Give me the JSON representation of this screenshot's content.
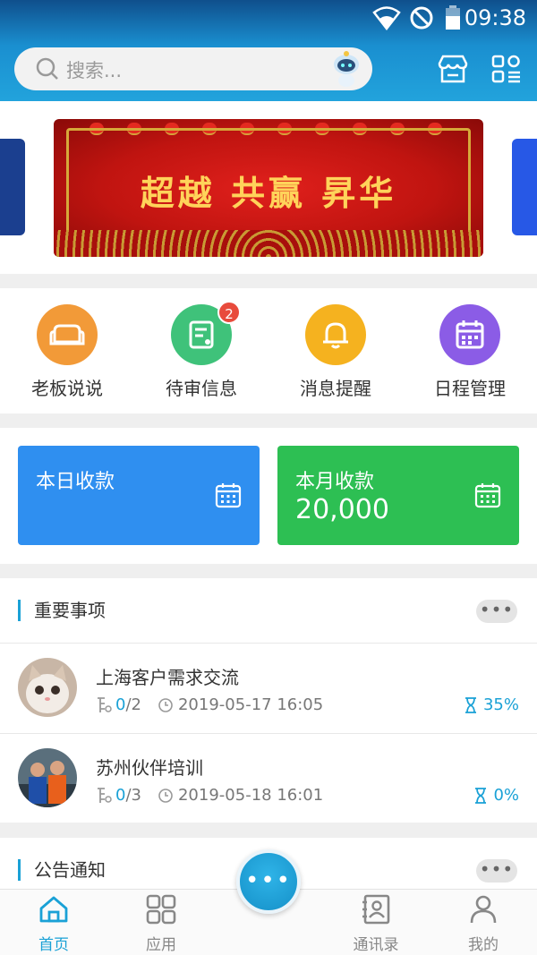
{
  "status_bar": {
    "time": "09:38"
  },
  "search": {
    "placeholder": "搜索..."
  },
  "banner": {
    "slogan": "超越 共赢 昇华"
  },
  "quick_actions": [
    {
      "label": "老板说说",
      "icon": "sofa-icon",
      "color": "#f29a38"
    },
    {
      "label": "待审信息",
      "icon": "review-document-icon",
      "color": "#3fc27a",
      "badge": "2"
    },
    {
      "label": "消息提醒",
      "icon": "bell-icon",
      "color": "#f5b21f"
    },
    {
      "label": "日程管理",
      "icon": "calendar-icon",
      "color": "#8b5ce6"
    }
  ],
  "stats": [
    {
      "title": "本日收款",
      "value": "",
      "color": "#2f8ff0"
    },
    {
      "title": "本月收款",
      "value": "20,000",
      "color": "#2dbf53"
    }
  ],
  "important": {
    "title": "重要事项",
    "more": "•••",
    "items": [
      {
        "name": "上海客户需求交流",
        "done": "0",
        "total": "/2",
        "time": "2019-05-17 16:05",
        "progress": "35%"
      },
      {
        "name": "苏州伙伴培训",
        "done": "0",
        "total": "/3",
        "time": "2019-05-18 16:01",
        "progress": "0%"
      }
    ]
  },
  "notice": {
    "title": "公告通知",
    "more": "•••"
  },
  "tabs": [
    {
      "label": "首页",
      "icon": "home-icon",
      "active": true
    },
    {
      "label": "应用",
      "icon": "apps-grid-icon"
    },
    {
      "label": "通讯录",
      "icon": "contacts-icon"
    },
    {
      "label": "我的",
      "icon": "profile-icon"
    }
  ],
  "fab": {
    "icon": "more-dots-icon"
  },
  "colors": {
    "accent": "#1aa1d6",
    "header": "#1a8fd0",
    "badge": "#e84b3c"
  }
}
